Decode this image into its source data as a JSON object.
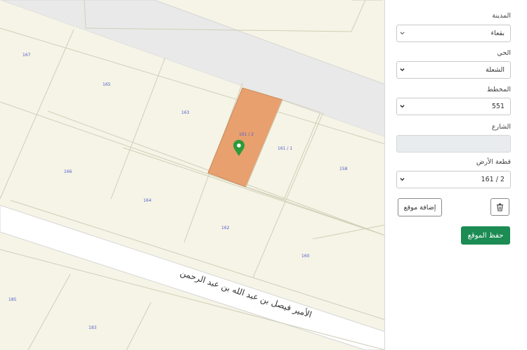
{
  "map": {
    "plots": [
      {
        "id": "p167",
        "label": "167"
      },
      {
        "id": "p165",
        "label": "165"
      },
      {
        "id": "p163",
        "label": "163"
      },
      {
        "id": "p166",
        "label": "166"
      },
      {
        "id": "p164",
        "label": "164"
      },
      {
        "id": "p162",
        "label": "162"
      },
      {
        "id": "p160",
        "label": "160"
      },
      {
        "id": "p158",
        "label": "158"
      },
      {
        "id": "p161-2",
        "label": "161 / 2"
      },
      {
        "id": "p161-1",
        "label": "161 / 1"
      },
      {
        "id": "p185",
        "label": "185"
      },
      {
        "id": "p183",
        "label": "183"
      }
    ],
    "street_name": "الأمير فيصل بن عبد الله بن عبد الرحمن",
    "selected_color": "#e8a06e",
    "marker_color": "#2e9a3a"
  },
  "form": {
    "city": {
      "label": "المدينة",
      "value": "بقعاء"
    },
    "district": {
      "label": "الحي",
      "value": "الشعلة"
    },
    "plan": {
      "label": "المخطط",
      "value": "551"
    },
    "street": {
      "label": "الشارع",
      "value": ""
    },
    "parcel": {
      "label": "قطعة الأرض",
      "value": "161 / 2"
    },
    "add_location_label": "إضافة موقع",
    "save_label": "حفظ الموقع"
  },
  "colors": {
    "save_button": "#1c8c54",
    "map_background": "#f6f4e6",
    "road": "#e9e9e9"
  }
}
